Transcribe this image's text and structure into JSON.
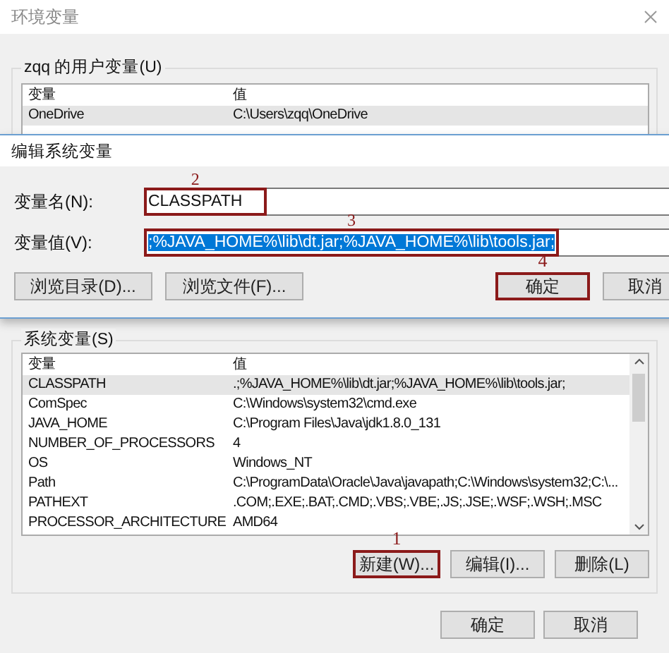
{
  "environment_window": {
    "title": "环境变量",
    "user_variables": {
      "label": "zqq 的用户变量(U)",
      "columns": [
        "变量",
        "值"
      ],
      "rows": [
        {
          "name": "OneDrive",
          "value": "C:\\Users\\zqq\\OneDrive",
          "selected": true
        }
      ]
    },
    "system_variables": {
      "label": "系统变量(S)",
      "columns": [
        "变量",
        "值"
      ],
      "rows": [
        {
          "name": "CLASSPATH",
          "value": ".;%JAVA_HOME%\\lib\\dt.jar;%JAVA_HOME%\\lib\\tools.jar;",
          "selected": true
        },
        {
          "name": "ComSpec",
          "value": "C:\\Windows\\system32\\cmd.exe",
          "selected": false
        },
        {
          "name": "JAVA_HOME",
          "value": "C:\\Program Files\\Java\\jdk1.8.0_131",
          "selected": false
        },
        {
          "name": "NUMBER_OF_PROCESSORS",
          "value": "4",
          "selected": false
        },
        {
          "name": "OS",
          "value": "Windows_NT",
          "selected": false
        },
        {
          "name": "Path",
          "value": "C:\\ProgramData\\Oracle\\Java\\javapath;C:\\Windows\\system32;C:\\...",
          "selected": false
        },
        {
          "name": "PATHEXT",
          "value": ".COM;.EXE;.BAT;.CMD;.VBS;.VBE;.JS;.JSE;.WSF;.WSH;.MSC",
          "selected": false
        },
        {
          "name": "PROCESSOR_ARCHITECTURE",
          "value": "AMD64",
          "selected": false
        }
      ],
      "buttons": [
        {
          "label": "新建(W)...",
          "highlighted": true,
          "annotation": "1"
        },
        {
          "label": "编辑(I)...",
          "highlighted": false
        },
        {
          "label": "删除(L)",
          "highlighted": false
        }
      ]
    },
    "buttons": [
      {
        "label": "确定",
        "highlighted": false
      },
      {
        "label": "取消",
        "highlighted": false
      }
    ]
  },
  "edit_dialog": {
    "title": "编辑系统变量",
    "fields": [
      {
        "label": "变量名(N):",
        "value": "CLASSPATH",
        "selected": false,
        "highlighted": true,
        "annotation": "2"
      },
      {
        "label": "变量值(V):",
        "value": ";%JAVA_HOME%\\lib\\dt.jar;%JAVA_HOME%\\lib\\tools.jar;",
        "selected": true,
        "highlighted": true,
        "annotation": "3"
      }
    ],
    "buttons": [
      {
        "label": "浏览目录(D)...",
        "highlighted": false
      },
      {
        "label": "浏览文件(F)...",
        "highlighted": false
      },
      {
        "label": "确定",
        "highlighted": true,
        "annotation": "4"
      },
      {
        "label": "取消",
        "highlighted": false
      }
    ]
  }
}
